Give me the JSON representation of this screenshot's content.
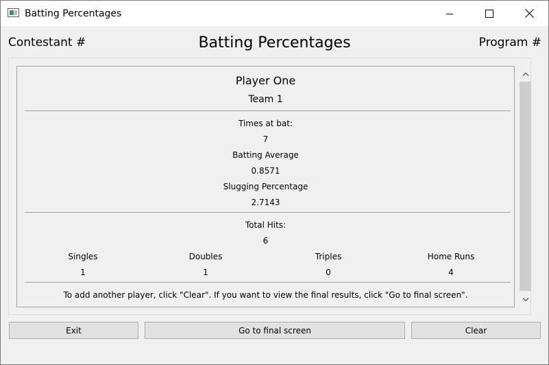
{
  "window": {
    "title": "Batting Percentages"
  },
  "header": {
    "left": "Contestant #",
    "center": "Batting Percentages",
    "right": "Program #"
  },
  "player": {
    "name": "Player One",
    "team": "Team 1"
  },
  "stats": {
    "times_at_bat_label": "Times at bat:",
    "times_at_bat_value": "7",
    "batting_average_label": "Batting Average",
    "batting_average_value": "0.8571",
    "slugging_label": "Slugging Percentage",
    "slugging_value": "2.7143",
    "total_hits_label": "Total Hits:",
    "total_hits_value": "6",
    "hit_types": [
      {
        "label": "Singles",
        "value": "1"
      },
      {
        "label": "Doubles",
        "value": "1"
      },
      {
        "label": "Triples",
        "value": "0"
      },
      {
        "label": "Home Runs",
        "value": "4"
      }
    ]
  },
  "instructions": "To add another player, click \"Clear\". If you want to view the final results, click \"Go to final screen\".",
  "buttons": {
    "exit": "Exit",
    "final": "Go to final screen",
    "clear": "Clear"
  }
}
